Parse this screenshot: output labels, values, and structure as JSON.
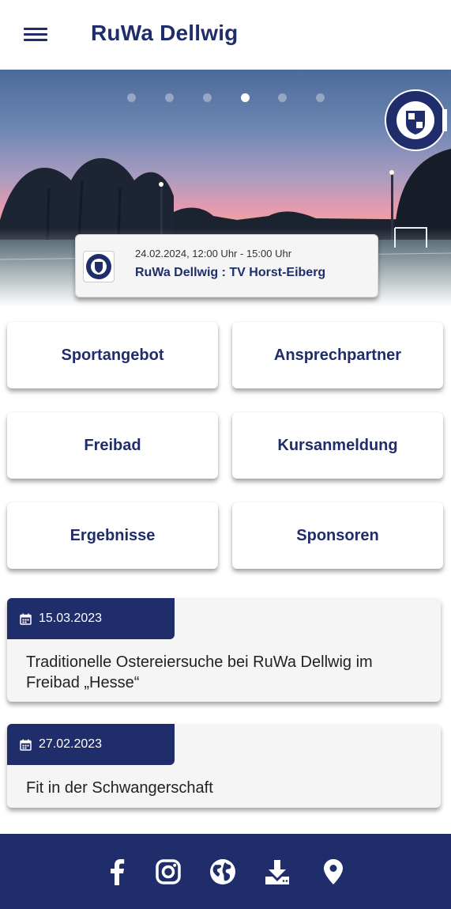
{
  "header": {
    "title": "RuWa Dellwig",
    "menu_icon": "hamburger-menu-icon"
  },
  "hero": {
    "slide_count": 6,
    "active_slide": 4,
    "crest_logo": "club-crest-logo"
  },
  "next_match": {
    "datetime": "24.02.2024, 12:00 Uhr - 15:00 Uhr",
    "teams": "RuWa Dellwig : TV Horst-Eiberg"
  },
  "menu": {
    "sportangebot": "Sportangebot",
    "ansprechpartner": "Ansprechpartner",
    "freibad": "Freibad",
    "kursanmeldung": "Kursanmeldung",
    "ergebnisse": "Ergebnisse",
    "sponsoren": "Sponsoren"
  },
  "news": [
    {
      "date": "15.03.2023",
      "title": "Traditionelle Ostereiersuche bei RuWa Dellwig im Freibad „Hesse“"
    },
    {
      "date": "27.02.2023",
      "title": "Fit in der Schwangerschaft"
    }
  ],
  "footer": {
    "icons": [
      "facebook-icon",
      "instagram-icon",
      "globe-icon",
      "download-icon",
      "location-pin-icon"
    ]
  },
  "colors": {
    "primary": "#1f2d6b",
    "card_bg": "#f5f5f5"
  }
}
